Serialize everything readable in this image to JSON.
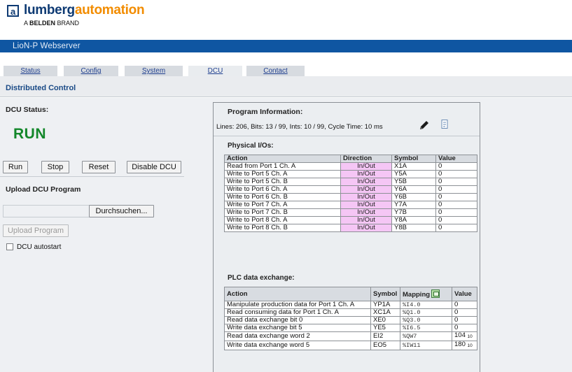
{
  "header": {
    "brand_part1": "lumberg",
    "brand_part2": "automation",
    "tagline_prefix": "A ",
    "tagline_bold": "BELDEN",
    "tagline_suffix": " BRAND",
    "logo_letter": "a"
  },
  "titlebar": {
    "title": "LioN-P Webserver"
  },
  "tabs": [
    {
      "label": "Status",
      "active": false
    },
    {
      "label": "Config",
      "active": false
    },
    {
      "label": "System",
      "active": false
    },
    {
      "label": "DCU",
      "active": true
    },
    {
      "label": "Contact",
      "active": false
    }
  ],
  "section": {
    "title": "Distributed Control"
  },
  "dcu": {
    "status_label": "DCU Status:",
    "status_value": "RUN",
    "buttons": {
      "run": "Run",
      "stop": "Stop",
      "reset": "Reset",
      "disable": "Disable DCU"
    },
    "upload_label": "Upload DCU Program",
    "browse_button": "Durchsuchen...",
    "upload_button": "Upload Program",
    "autostart_label": "DCU autostart",
    "autostart_checked": false
  },
  "program_info": {
    "title": "Program Information:",
    "stats": "Lines: 206, Bits: 13 / 99, Ints: 10 / 99, Cycle Time: 10 ms",
    "edit_icon": "pencil-icon",
    "export_icon": "document-icon"
  },
  "physical_ios": {
    "title": "Physical I/Os:",
    "headers": {
      "action": "Action",
      "direction": "Direction",
      "symbol": "Symbol",
      "value": "Value"
    },
    "rows": [
      {
        "action": "Read from Port 1 Ch. A",
        "direction": "In/Out",
        "symbol": "X1A",
        "value": "0"
      },
      {
        "action": "Write to Port 5 Ch. A",
        "direction": "In/Out",
        "symbol": "Y5A",
        "value": "0"
      },
      {
        "action": "Write to Port 5 Ch. B",
        "direction": "In/Out",
        "symbol": "Y5B",
        "value": "0"
      },
      {
        "action": "Write to Port 6 Ch. A",
        "direction": "In/Out",
        "symbol": "Y6A",
        "value": "0"
      },
      {
        "action": "Write to Port 6 Ch. B",
        "direction": "In/Out",
        "symbol": "Y6B",
        "value": "0"
      },
      {
        "action": "Write to Port 7 Ch. A",
        "direction": "In/Out",
        "symbol": "Y7A",
        "value": "0"
      },
      {
        "action": "Write to Port 7 Ch. B",
        "direction": "In/Out",
        "symbol": "Y7B",
        "value": "0"
      },
      {
        "action": "Write to Port 8 Ch. A",
        "direction": "In/Out",
        "symbol": "Y8A",
        "value": "0"
      },
      {
        "action": "Write to Port 8 Ch. B",
        "direction": "In/Out",
        "symbol": "Y8B",
        "value": "0"
      }
    ]
  },
  "plc_exchange": {
    "title": "PLC data exchange:",
    "headers": {
      "action": "Action",
      "symbol": "Symbol",
      "mapping": "Mapping",
      "value": "Value"
    },
    "mapping_icon": "calculator-icon",
    "rows": [
      {
        "action": "Manipulate production data for Port 1 Ch. A",
        "symbol": "YP1A",
        "mapping": "%I4.0",
        "value": "0",
        "base": ""
      },
      {
        "action": "Read consuming data for Port 1 Ch. A",
        "symbol": "XC1A",
        "mapping": "%Q1.0",
        "value": "0",
        "base": ""
      },
      {
        "action": "Read data exchange bit 0",
        "symbol": "XE0",
        "mapping": "%Q3.0",
        "value": "0",
        "base": ""
      },
      {
        "action": "Write data exchange bit 5",
        "symbol": "YE5",
        "mapping": "%I6.5",
        "value": "0",
        "base": ""
      },
      {
        "action": "Read data exchange word 2",
        "symbol": "EI2",
        "mapping": "%QW7",
        "value": "104",
        "base": "10"
      },
      {
        "action": "Write data exchange word 5",
        "symbol": "EO5",
        "mapping": "%IW11",
        "value": "180",
        "base": "10"
      }
    ]
  }
}
